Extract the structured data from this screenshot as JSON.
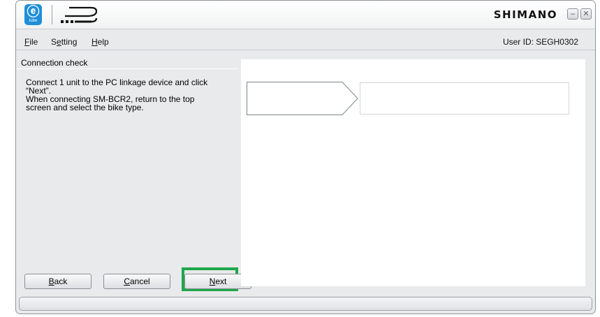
{
  "app": {
    "logo_small_text": "tube",
    "brand": "SHIMANO",
    "user_id": "User ID: SEGH0302"
  },
  "window_controls": {
    "minimize_icon": "minimize-icon",
    "close_icon": "close-icon"
  },
  "menu": {
    "items": [
      {
        "label": "File",
        "accel": "F"
      },
      {
        "label": "Setting",
        "accel": "e"
      },
      {
        "label": "Help",
        "accel": "H"
      }
    ]
  },
  "left_panel": {
    "title": "Connection check",
    "instruction_lines": [
      "Connect 1 unit to the PC linkage device and click",
      "“Next”.",
      "When connecting SM-BCR2, return to the top",
      "screen and select the bike type."
    ]
  },
  "buttons": {
    "back": "Back",
    "cancel": "Cancel",
    "next": "Next"
  },
  "colors": {
    "highlight": "#1fa64c",
    "logo_blue": "#1e8fd8"
  }
}
